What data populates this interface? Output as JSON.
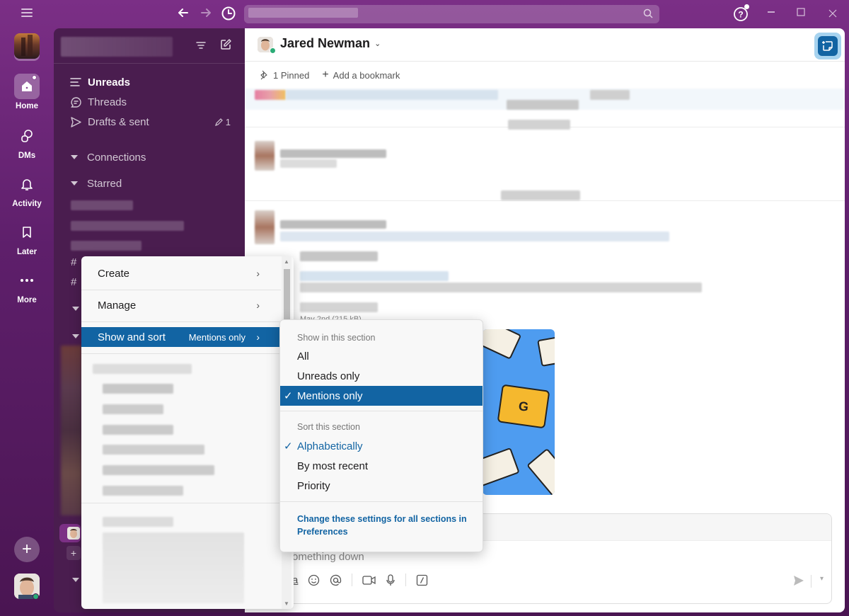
{
  "titlebar": {
    "back_icon": "arrow-left-icon",
    "forward_icon": "arrow-right-icon",
    "history_icon": "clock-icon",
    "search_icon": "search-icon",
    "help_icon": "help-icon",
    "minimize_icon": "minimize-icon",
    "maximize_icon": "maximize-icon",
    "close_icon": "close-icon"
  },
  "rail": {
    "items": [
      {
        "label": "Home",
        "icon": "home-icon"
      },
      {
        "label": "DMs",
        "icon": "dms-icon"
      },
      {
        "label": "Activity",
        "icon": "bell-icon"
      },
      {
        "label": "Later",
        "icon": "bookmark-icon"
      },
      {
        "label": "More",
        "icon": "more-icon"
      }
    ],
    "add_label": "+"
  },
  "sidebar": {
    "nav": [
      {
        "label": "Unreads",
        "icon": "unreads-icon"
      },
      {
        "label": "Threads",
        "icon": "threads-icon"
      },
      {
        "label": "Drafts & sent",
        "icon": "send-icon",
        "badge": "1"
      }
    ],
    "sections": [
      {
        "label": "Connections"
      },
      {
        "label": "Starred"
      }
    ],
    "hash": "#",
    "add_channel": "+"
  },
  "channel": {
    "title": "Jared Newman",
    "chevron": "⌄",
    "pinned": "1 Pinned",
    "add_bookmark": "Add a bookmark",
    "file_meta": "May 2nd (215 kB)"
  },
  "attachment": {
    "key_letter": "G"
  },
  "composer": {
    "placeholder": "Jot something down",
    "visible_placeholder": "omething down"
  },
  "context_menu": {
    "items": [
      {
        "label": "Create",
        "chevron": "›"
      },
      {
        "label": "Manage",
        "chevron": "›"
      },
      {
        "label": "Show and sort",
        "value": "Mentions only",
        "chevron": "›",
        "selected": true
      }
    ]
  },
  "submenu": {
    "show_heading": "Show in this section",
    "show_options": [
      {
        "label": "All",
        "checked": false
      },
      {
        "label": "Unreads only",
        "checked": false
      },
      {
        "label": "Mentions only",
        "checked": true
      }
    ],
    "sort_heading": "Sort this section",
    "sort_options": [
      {
        "label": "Alphabetically",
        "checked": true
      },
      {
        "label": "By most recent",
        "checked": false
      },
      {
        "label": "Priority",
        "checked": false
      }
    ],
    "check_glyph": "✓",
    "footer_link": "Change these settings for all sections in Preferences"
  },
  "colors": {
    "brand_purple": "#4a1d4f",
    "accent_blue": "#1264a3",
    "presence_green": "#2bac76"
  }
}
